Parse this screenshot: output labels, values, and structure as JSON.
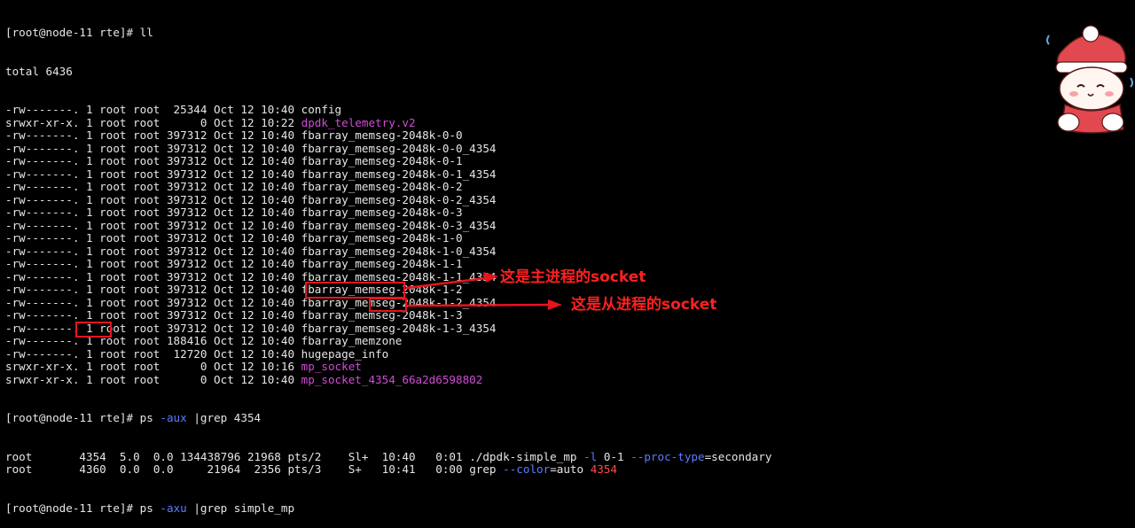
{
  "terminal": {
    "prompt_1": "[root@node-11 rte]# ll",
    "total": "total 6436",
    "listing": [
      {
        "perm": "-rw-------.",
        "links": "1",
        "owner": "root",
        "group": "root",
        "size": "25344",
        "date": "Oct 12 10:40",
        "name": "config",
        "kind": "plain"
      },
      {
        "perm": "srwxr-xr-x.",
        "links": "1",
        "owner": "root",
        "group": "root",
        "size": "0",
        "date": "Oct 12 10:22",
        "name": "dpdk_telemetry.v2",
        "kind": "socket"
      },
      {
        "perm": "-rw-------.",
        "links": "1",
        "owner": "root",
        "group": "root",
        "size": "397312",
        "date": "Oct 12 10:40",
        "name": "fbarray_memseg-2048k-0-0",
        "kind": "plain"
      },
      {
        "perm": "-rw-------.",
        "links": "1",
        "owner": "root",
        "group": "root",
        "size": "397312",
        "date": "Oct 12 10:40",
        "name": "fbarray_memseg-2048k-0-0_4354",
        "kind": "plain"
      },
      {
        "perm": "-rw-------.",
        "links": "1",
        "owner": "root",
        "group": "root",
        "size": "397312",
        "date": "Oct 12 10:40",
        "name": "fbarray_memseg-2048k-0-1",
        "kind": "plain"
      },
      {
        "perm": "-rw-------.",
        "links": "1",
        "owner": "root",
        "group": "root",
        "size": "397312",
        "date": "Oct 12 10:40",
        "name": "fbarray_memseg-2048k-0-1_4354",
        "kind": "plain"
      },
      {
        "perm": "-rw-------.",
        "links": "1",
        "owner": "root",
        "group": "root",
        "size": "397312",
        "date": "Oct 12 10:40",
        "name": "fbarray_memseg-2048k-0-2",
        "kind": "plain"
      },
      {
        "perm": "-rw-------.",
        "links": "1",
        "owner": "root",
        "group": "root",
        "size": "397312",
        "date": "Oct 12 10:40",
        "name": "fbarray_memseg-2048k-0-2_4354",
        "kind": "plain"
      },
      {
        "perm": "-rw-------.",
        "links": "1",
        "owner": "root",
        "group": "root",
        "size": "397312",
        "date": "Oct 12 10:40",
        "name": "fbarray_memseg-2048k-0-3",
        "kind": "plain"
      },
      {
        "perm": "-rw-------.",
        "links": "1",
        "owner": "root",
        "group": "root",
        "size": "397312",
        "date": "Oct 12 10:40",
        "name": "fbarray_memseg-2048k-0-3_4354",
        "kind": "plain"
      },
      {
        "perm": "-rw-------.",
        "links": "1",
        "owner": "root",
        "group": "root",
        "size": "397312",
        "date": "Oct 12 10:40",
        "name": "fbarray_memseg-2048k-1-0",
        "kind": "plain"
      },
      {
        "perm": "-rw-------.",
        "links": "1",
        "owner": "root",
        "group": "root",
        "size": "397312",
        "date": "Oct 12 10:40",
        "name": "fbarray_memseg-2048k-1-0_4354",
        "kind": "plain"
      },
      {
        "perm": "-rw-------.",
        "links": "1",
        "owner": "root",
        "group": "root",
        "size": "397312",
        "date": "Oct 12 10:40",
        "name": "fbarray_memseg-2048k-1-1",
        "kind": "plain"
      },
      {
        "perm": "-rw-------.",
        "links": "1",
        "owner": "root",
        "group": "root",
        "size": "397312",
        "date": "Oct 12 10:40",
        "name": "fbarray_memseg-2048k-1-1_4354",
        "kind": "plain"
      },
      {
        "perm": "-rw-------.",
        "links": "1",
        "owner": "root",
        "group": "root",
        "size": "397312",
        "date": "Oct 12 10:40",
        "name": "fbarray_memseg-2048k-1-2",
        "kind": "plain"
      },
      {
        "perm": "-rw-------.",
        "links": "1",
        "owner": "root",
        "group": "root",
        "size": "397312",
        "date": "Oct 12 10:40",
        "name": "fbarray_memseg-2048k-1-2_4354",
        "kind": "plain"
      },
      {
        "perm": "-rw-------.",
        "links": "1",
        "owner": "root",
        "group": "root",
        "size": "397312",
        "date": "Oct 12 10:40",
        "name": "fbarray_memseg-2048k-1-3",
        "kind": "plain"
      },
      {
        "perm": "-rw-------.",
        "links": "1",
        "owner": "root",
        "group": "root",
        "size": "397312",
        "date": "Oct 12 10:40",
        "name": "fbarray_memseg-2048k-1-3_4354",
        "kind": "plain"
      },
      {
        "perm": "-rw-------.",
        "links": "1",
        "owner": "root",
        "group": "root",
        "size": "188416",
        "date": "Oct 12 10:40",
        "name": "fbarray_memzone",
        "kind": "plain"
      },
      {
        "perm": "-rw-------.",
        "links": "1",
        "owner": "root",
        "group": "root",
        "size": "12720",
        "date": "Oct 12 10:40",
        "name": "hugepage_info",
        "kind": "plain"
      },
      {
        "perm": "srwxr-xr-x.",
        "links": "1",
        "owner": "root",
        "group": "root",
        "size": "0",
        "date": "Oct 12 10:16",
        "name": "mp_socket",
        "kind": "socket"
      },
      {
        "perm": "srwxr-xr-x.",
        "links": "1",
        "owner": "root",
        "group": "root",
        "size": "0",
        "date": "Oct 12 10:40",
        "name": "mp_socket_4354_66a2d6598802",
        "kind": "socket"
      }
    ],
    "prompt_2": {
      "prefix": "[root@node-11 rte]# ps ",
      "flag": "-aux",
      "rest": " |grep 4354"
    },
    "ps_rows": [
      {
        "user": "root",
        "pid": "4354",
        "cpu": "5.0",
        "mem": "0.0",
        "vsz": "134438796",
        "rss": "21968",
        "tty": "pts/2",
        "stat": "Sl+",
        "start": "10:40",
        "time": "0:01",
        "cmd_a": "./dpdk-simple_mp ",
        "cmd_flag1": "-l",
        "cmd_b": " 0-1 ",
        "cmd_flag2": "--proc-type",
        "cmd_c": "=secondary"
      },
      {
        "user": "root",
        "pid": "4360",
        "cpu": "0.0",
        "mem": "0.0",
        "vsz": "21964",
        "rss": "2356",
        "tty": "pts/3",
        "stat": "S+",
        "start": "10:41",
        "time": "0:00",
        "cmd_a": "grep ",
        "cmd_flag1": "--color",
        "cmd_b": "=auto ",
        "cmd_flag2": "",
        "cmd_c": "",
        "highlight": "4354"
      }
    ],
    "prompt_3": {
      "prefix": "[root@node-11 rte]# ps ",
      "flag": "-axu",
      "rest": " |grep simple_mp"
    }
  },
  "annotations": {
    "primary": "这是主进程的socket",
    "secondary": "这是从进程的socket"
  },
  "colors": {
    "background": "#000000",
    "text": "#e6e6e6",
    "socket_name": "#d14ad6",
    "flag": "#5b7cff",
    "grep_match": "#ff4b4b",
    "annotation": "#e8141c"
  },
  "sticker": {
    "icon": "snow-doll-sticker-icon"
  }
}
